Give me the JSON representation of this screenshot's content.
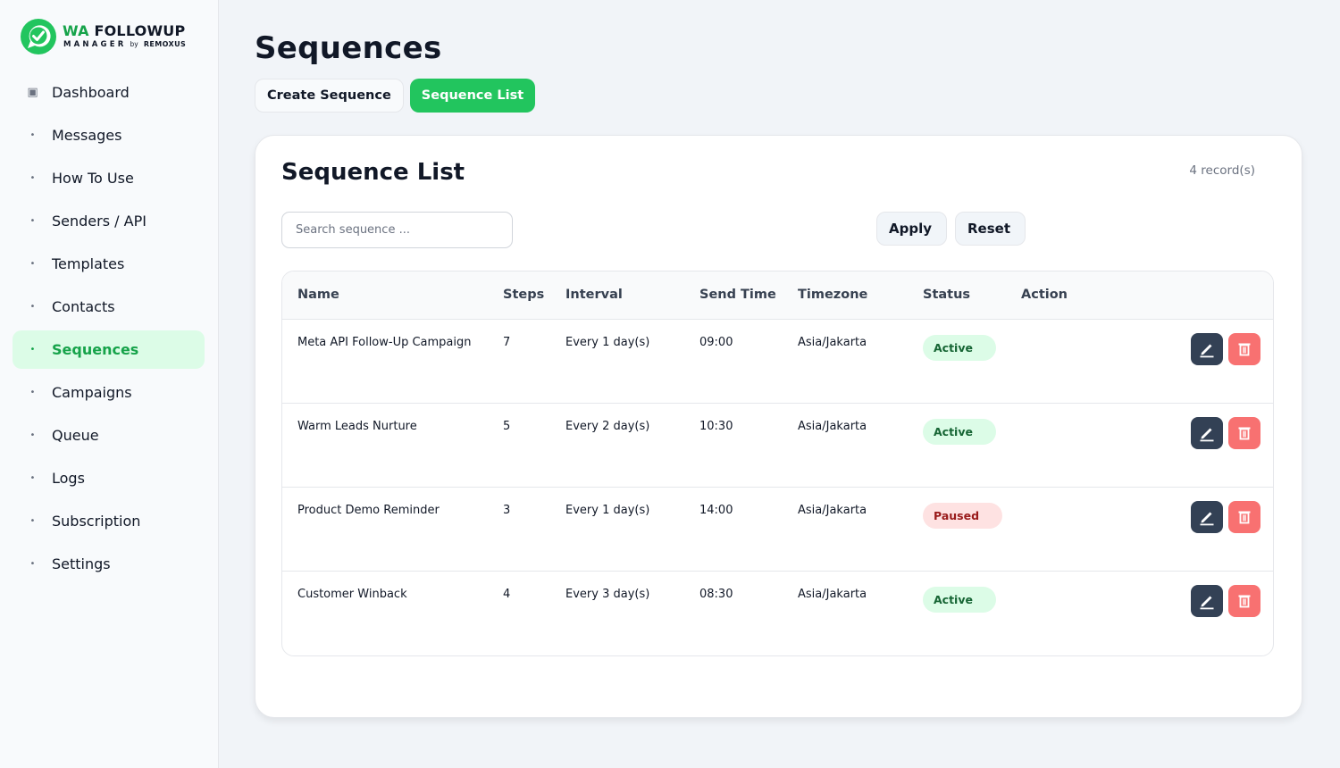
{
  "logo": {
    "title_prefix": "WA",
    "title_rest": " FOLLOWUP",
    "subtitle": "MANAGER",
    "by": "by",
    "brand": "REMOXUS"
  },
  "sidebar": {
    "items": [
      {
        "label": "Dashboard",
        "icon": "square-icon",
        "bullet": "▣"
      },
      {
        "label": "Messages",
        "icon": "bullet-icon",
        "bullet": "•"
      },
      {
        "label": "How To Use",
        "icon": "bullet-icon",
        "bullet": "•"
      },
      {
        "label": "Senders / API",
        "icon": "bullet-icon",
        "bullet": "•"
      },
      {
        "label": "Templates",
        "icon": "bullet-icon",
        "bullet": "•"
      },
      {
        "label": "Contacts",
        "icon": "bullet-icon",
        "bullet": "•"
      },
      {
        "label": "Sequences",
        "icon": "bullet-icon",
        "bullet": "•",
        "active": true
      },
      {
        "label": "Campaigns",
        "icon": "bullet-icon",
        "bullet": "•"
      },
      {
        "label": "Queue",
        "icon": "bullet-icon",
        "bullet": "•"
      },
      {
        "label": "Logs",
        "icon": "bullet-icon",
        "bullet": "•"
      },
      {
        "label": "Subscription",
        "icon": "bullet-icon",
        "bullet": "•"
      },
      {
        "label": "Settings",
        "icon": "bullet-icon",
        "bullet": "•"
      }
    ]
  },
  "header": {
    "title": "Sequences"
  },
  "tabs": [
    {
      "label": "Create Sequence",
      "active": false
    },
    {
      "label": "Sequence List",
      "active": true
    }
  ],
  "card": {
    "title": "Sequence List",
    "record_count": "4 record(s)",
    "search_placeholder": "Search sequence ...",
    "search_value": "",
    "apply_label": "Apply",
    "reset_label": "Reset"
  },
  "table": {
    "columns": [
      "Name",
      "Steps",
      "Interval",
      "Send Time",
      "Timezone",
      "Status",
      "Action"
    ],
    "rows": [
      {
        "name": "Meta API Follow-Up Campaign",
        "steps": "7",
        "interval": "Every 1 day(s)",
        "send_time": "09:00",
        "timezone": "Asia/Jakarta",
        "status": "Active"
      },
      {
        "name": "Warm Leads Nurture",
        "steps": "5",
        "interval": "Every 2 day(s)",
        "send_time": "10:30",
        "timezone": "Asia/Jakarta",
        "status": "Active"
      },
      {
        "name": "Product Demo Reminder",
        "steps": "3",
        "interval": "Every 1 day(s)",
        "send_time": "14:00",
        "timezone": "Asia/Jakarta",
        "status": "Paused"
      },
      {
        "name": "Customer Winback",
        "steps": "4",
        "interval": "Every 3 day(s)",
        "send_time": "08:30",
        "timezone": "Asia/Jakarta",
        "status": "Active"
      }
    ]
  },
  "colors": {
    "brand_green": "#22c55e",
    "active_bg": "#dcfce7",
    "paused_bg": "#fee2e2",
    "edit_button": "#334155",
    "delete_button": "#f87171"
  }
}
